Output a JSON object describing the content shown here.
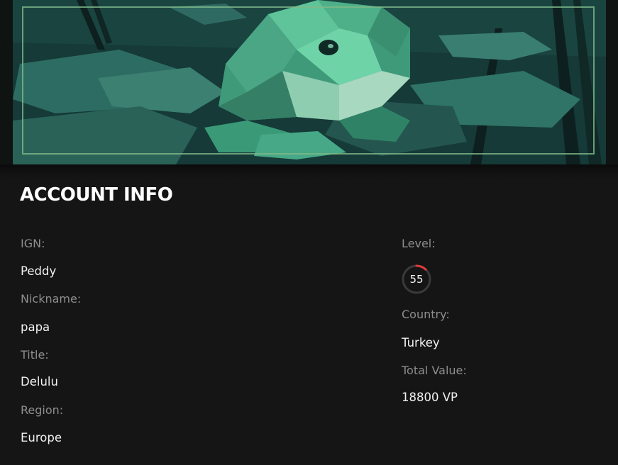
{
  "header": {
    "title": "ACCOUNT INFO"
  },
  "account": {
    "ign_label": "IGN:",
    "ign": "Peddy",
    "nickname_label": "Nickname:",
    "nickname": "papa",
    "title_label": "Title:",
    "title": "Delulu",
    "region_label": "Region:",
    "region": "Europe",
    "level_label": "Level:",
    "level": "55",
    "level_progress": 0.12,
    "country_label": "Country:",
    "country": "Turkey",
    "total_value_label": "Total Value:",
    "total_value": "18800 VP"
  },
  "colors": {
    "background": "#151515",
    "label": "#8e8e8e",
    "value": "#f2f2f2",
    "level_ring_track": "#3a3a3a",
    "level_ring_fill": "#e03a3a",
    "banner_frame": "#7fb98a"
  },
  "banner": {
    "image": "low-poly-frog-on-lily-pads"
  }
}
